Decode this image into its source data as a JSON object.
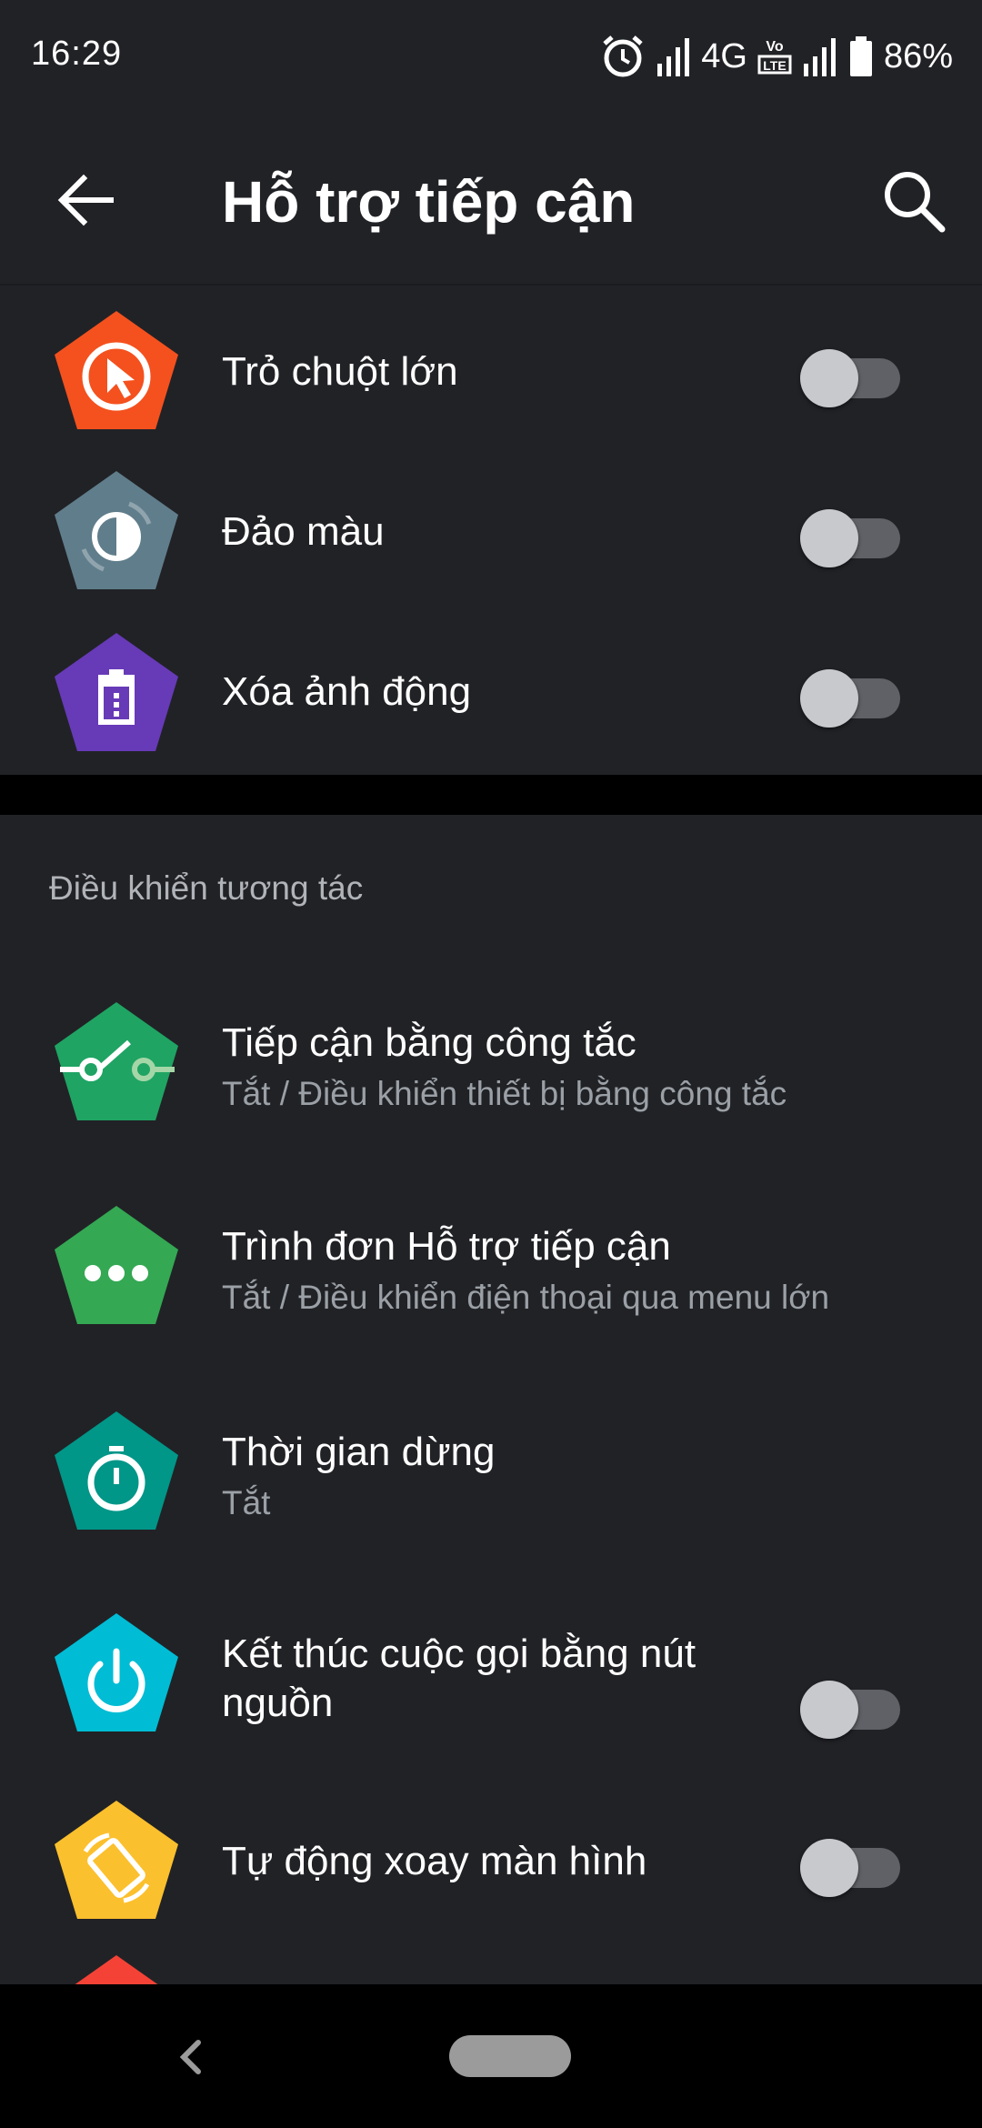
{
  "status_bar": {
    "time": "16:29",
    "network": "4G",
    "battery": "86%"
  },
  "app_bar": {
    "title": "Hỗ trợ tiếp cận"
  },
  "items_top": [
    {
      "title": "Trỏ chuột lớn",
      "icon": "large-pointer-icon",
      "color": "#f4511e",
      "toggle": false
    },
    {
      "title": "Đảo màu",
      "icon": "color-inversion-icon",
      "color": "#607d8b",
      "toggle": false
    },
    {
      "title": "Xóa ảnh động",
      "icon": "remove-animations-icon",
      "color": "#673ab7",
      "toggle": false
    }
  ],
  "section": {
    "header": "Điều khiển tương tác"
  },
  "items_interaction": [
    {
      "title": "Tiếp cận bằng công tắc",
      "subtitle": "Tắt / Điều khiển thiết bị bằng công tắc",
      "icon": "switch-access-icon",
      "color": "#1fa463"
    },
    {
      "title": "Trình đơn Hỗ trợ tiếp cận",
      "subtitle": "Tắt / Điều khiển điện thoại qua menu lớn",
      "icon": "accessibility-menu-icon",
      "color": "#34a853"
    },
    {
      "title": "Thời gian dừng",
      "subtitle": "Tắt",
      "icon": "dwell-timing-icon",
      "color": "#009688"
    },
    {
      "title_line1": "Kết thúc cuộc gọi bằng nút",
      "title_line2": "nguồn",
      "icon": "power-button-ends-call-icon",
      "color": "#00bcd4",
      "toggle": false
    },
    {
      "title": "Tự động xoay màn hình",
      "icon": "auto-rotate-icon",
      "color": "#fbc02d",
      "toggle": false
    },
    {
      "icon": "partial-item-icon",
      "color": "#f44336"
    }
  ]
}
